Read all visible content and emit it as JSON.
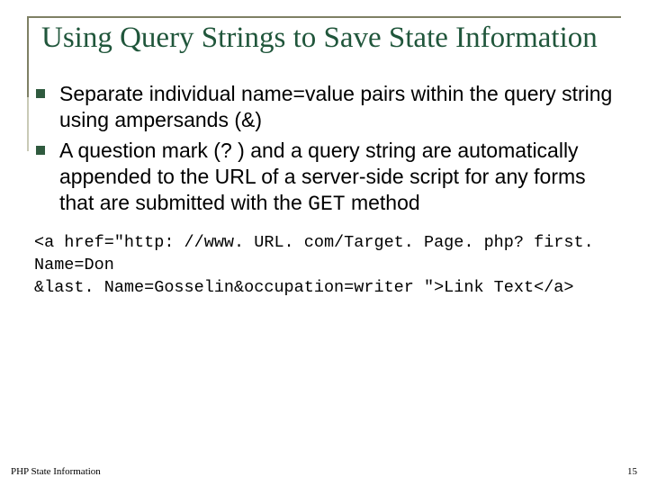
{
  "title": "Using Query Strings to Save State Information",
  "bullets": [
    {
      "text": "Separate individual name=value pairs within the query string using ampersands (&)"
    },
    {
      "pre": "A question mark (? ) and a query string are automatically appended to the URL of a server-side script for any forms that are submitted with the ",
      "code": "GET",
      "post": " method"
    }
  ],
  "code": "<a href=\"http: //www. URL. com/Target. Page. php? first. Name=Don\n&last. Name=Gosselin&occupation=writer \">Link Text</a>",
  "footer_text": "PHP State Information",
  "page_number": "15"
}
